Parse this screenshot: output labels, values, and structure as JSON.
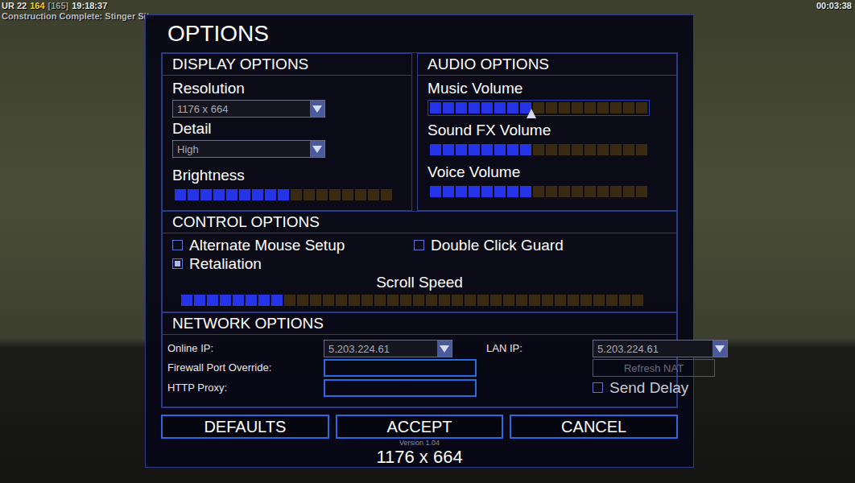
{
  "hud": {
    "resources": "UR 22",
    "power": "164",
    "power_max": "[165]",
    "clock": "19:18:37",
    "message": "Construction Complete: Stinger Site",
    "timer": "00:03:38"
  },
  "dialog": {
    "title": "OPTIONS",
    "display": {
      "title": "DISPLAY OPTIONS",
      "dropdowns": [
        {
          "label": "Resolution",
          "value": "1176 x 664"
        },
        {
          "label": "Detail",
          "value": "High"
        }
      ],
      "slider": {
        "label": "Brightness",
        "level": 0.53
      }
    },
    "audio": {
      "title": "AUDIO OPTIONS",
      "sliders": [
        {
          "label": "Music Volume",
          "level": 0.47,
          "focused": true
        },
        {
          "label": "Sound FX Volume",
          "level": 0.47,
          "focused": false
        },
        {
          "label": "Voice Volume",
          "level": 0.47,
          "focused": false
        }
      ]
    },
    "control": {
      "title": "CONTROL OPTIONS",
      "checkboxes": [
        {
          "label": "Alternate Mouse Setup",
          "checked": false
        },
        {
          "label": "Double Click Guard",
          "checked": false
        },
        {
          "label": "Retaliation",
          "checked": true
        }
      ],
      "slider": {
        "label": "Scroll Speed",
        "level": 0.22
      }
    },
    "network": {
      "title": "NETWORK OPTIONS",
      "online_ip": {
        "label": "Online IP:",
        "value": "5.203.224.61"
      },
      "lan_ip": {
        "label": "LAN IP:",
        "value": "5.203.224.61"
      },
      "firewall": {
        "label": "Firewall Port Override:",
        "value": ""
      },
      "proxy": {
        "label": "HTTP Proxy:",
        "value": ""
      },
      "refresh_nat": {
        "label": "Refresh NAT",
        "disabled": true
      },
      "send_delay": {
        "label": "Send Delay",
        "checked": false
      }
    },
    "buttons": [
      "DEFAULTS",
      "ACCEPT",
      "CANCEL"
    ],
    "version": "Version 1.04",
    "message": "1176 x 664"
  }
}
